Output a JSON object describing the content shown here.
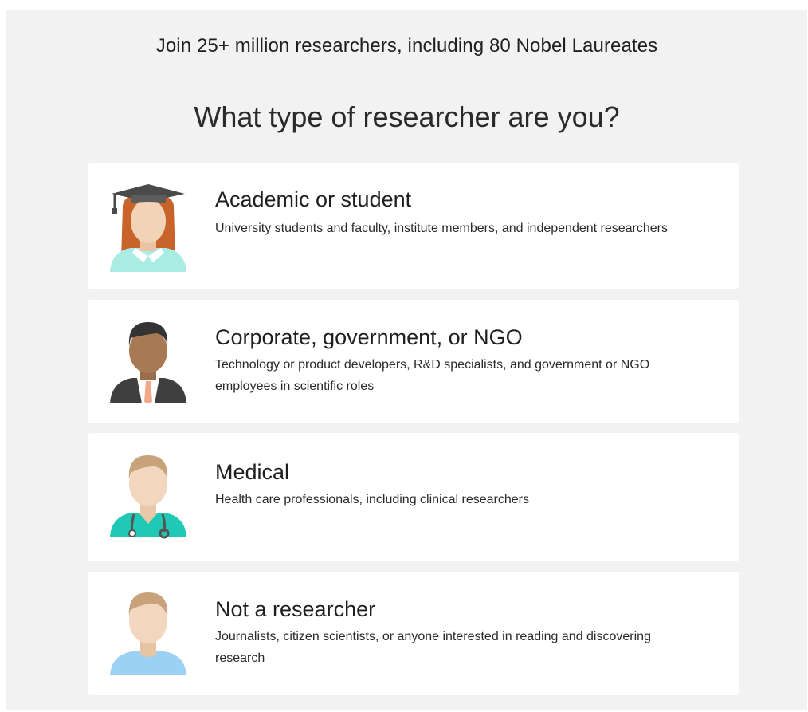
{
  "header": {
    "tagline": "Join 25+ million researchers, including 80 Nobel Laureates",
    "question": "What type of researcher are you?"
  },
  "options": [
    {
      "title": "Academic or student",
      "description": "University students and faculty, institute members, and independent researchers",
      "icon": "academic-student-avatar-icon"
    },
    {
      "title": "Corporate, government, or NGO",
      "description": "Technology or product developers, R&D specialists, and government or NGO employees in scientific roles",
      "icon": "corporate-avatar-icon"
    },
    {
      "title": "Medical",
      "description": "Health care professionals, including clinical researchers",
      "icon": "medical-avatar-icon"
    },
    {
      "title": "Not a researcher",
      "description": "Journalists, citizen scientists, or anyone interested in reading and discovering research",
      "icon": "non-researcher-avatar-icon"
    }
  ],
  "colors": {
    "page_background": "#f2f2f2",
    "card_background": "#ffffff",
    "text_primary": "#1f1f1f"
  }
}
